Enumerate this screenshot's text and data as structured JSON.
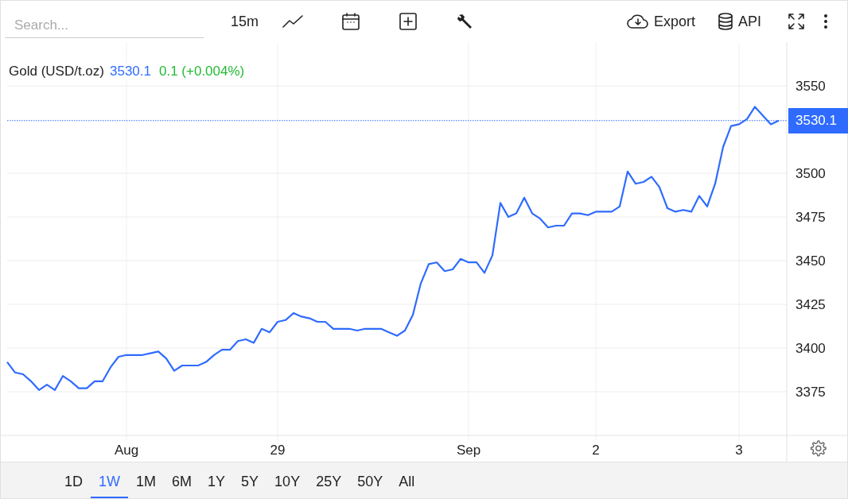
{
  "toolbar": {
    "search": {
      "placeholder": "Search..."
    },
    "interval": "15m",
    "export": "Export",
    "api": "API"
  },
  "legend": {
    "price": "3530.1",
    "change": "0.1 (+0.004%)"
  },
  "price_label": "3530.1",
  "chart_data": {
    "type": "line",
    "categories": [
      null,
      null,
      null,
      null,
      null,
      null,
      null,
      null,
      null,
      null,
      null,
      null,
      null,
      null,
      null,
      "Aug",
      null,
      null,
      null,
      null,
      null,
      null,
      null,
      null,
      null,
      null,
      null,
      null,
      null,
      null,
      null,
      null,
      null,
      null,
      "29",
      null,
      null,
      null,
      null,
      null,
      null,
      null,
      null,
      null,
      null,
      null,
      null,
      null,
      null,
      null,
      null,
      null,
      null,
      null,
      null,
      null,
      null,
      null,
      "Sep",
      null,
      null,
      null,
      null,
      null,
      null,
      null,
      null,
      null,
      null,
      null,
      null,
      null,
      null,
      null,
      "2",
      null,
      null,
      null,
      null,
      null,
      null,
      null,
      null,
      null,
      null,
      null,
      null,
      null,
      null,
      null,
      null,
      null,
      "3",
      null,
      null,
      null,
      null,
      null
    ],
    "series": [
      {
        "name": "Gold (USD/t.oz)",
        "color": "#2f6bff",
        "values": [
          3392,
          3386,
          3385,
          3381,
          3376,
          3379,
          3376,
          3384,
          3381,
          3377,
          3377,
          3381,
          3381,
          3389,
          3395,
          3396,
          3396,
          3396,
          3397,
          3398,
          3394,
          3387,
          3390,
          3390,
          3390,
          3392,
          3396,
          3399,
          3399,
          3404,
          3405,
          3403,
          3411,
          3409,
          3415,
          3416,
          3420,
          3418,
          3417,
          3415,
          3415,
          3411,
          3411,
          3411,
          3410,
          3411,
          3411,
          3411,
          3409,
          3407,
          3410,
          3419,
          3437,
          3448,
          3449,
          3444,
          3445,
          3451,
          3449,
          3449,
          3443,
          3453,
          3483,
          3475,
          3477,
          3486,
          3477,
          3474,
          3469,
          3470,
          3470,
          3477,
          3477,
          3476,
          3478,
          3478,
          3478,
          3481,
          3501,
          3494,
          3495,
          3498,
          3492,
          3480,
          3478,
          3479,
          3478,
          3487,
          3481,
          3494,
          3515,
          3527,
          3528,
          3531,
          3538,
          3533,
          3528,
          3530.1
        ]
      }
    ],
    "ylim": [
      3350,
      3575
    ],
    "grid": true,
    "ref_lines": [
      {
        "axis": "y",
        "value": 3530.1,
        "color": "#2f6bff"
      }
    ],
    "yticks": [
      3375,
      3400,
      3425,
      3450,
      3475,
      3500,
      3550
    ]
  },
  "ranges": [
    {
      "label": "1D",
      "selected": false
    },
    {
      "label": "1W",
      "selected": true
    },
    {
      "label": "1M",
      "selected": false
    },
    {
      "label": "6M",
      "selected": false
    },
    {
      "label": "1Y",
      "selected": false
    },
    {
      "label": "5Y",
      "selected": false
    },
    {
      "label": "10Y",
      "selected": false
    },
    {
      "label": "25Y",
      "selected": false
    },
    {
      "label": "50Y",
      "selected": false
    },
    {
      "label": "All",
      "selected": false
    }
  ]
}
